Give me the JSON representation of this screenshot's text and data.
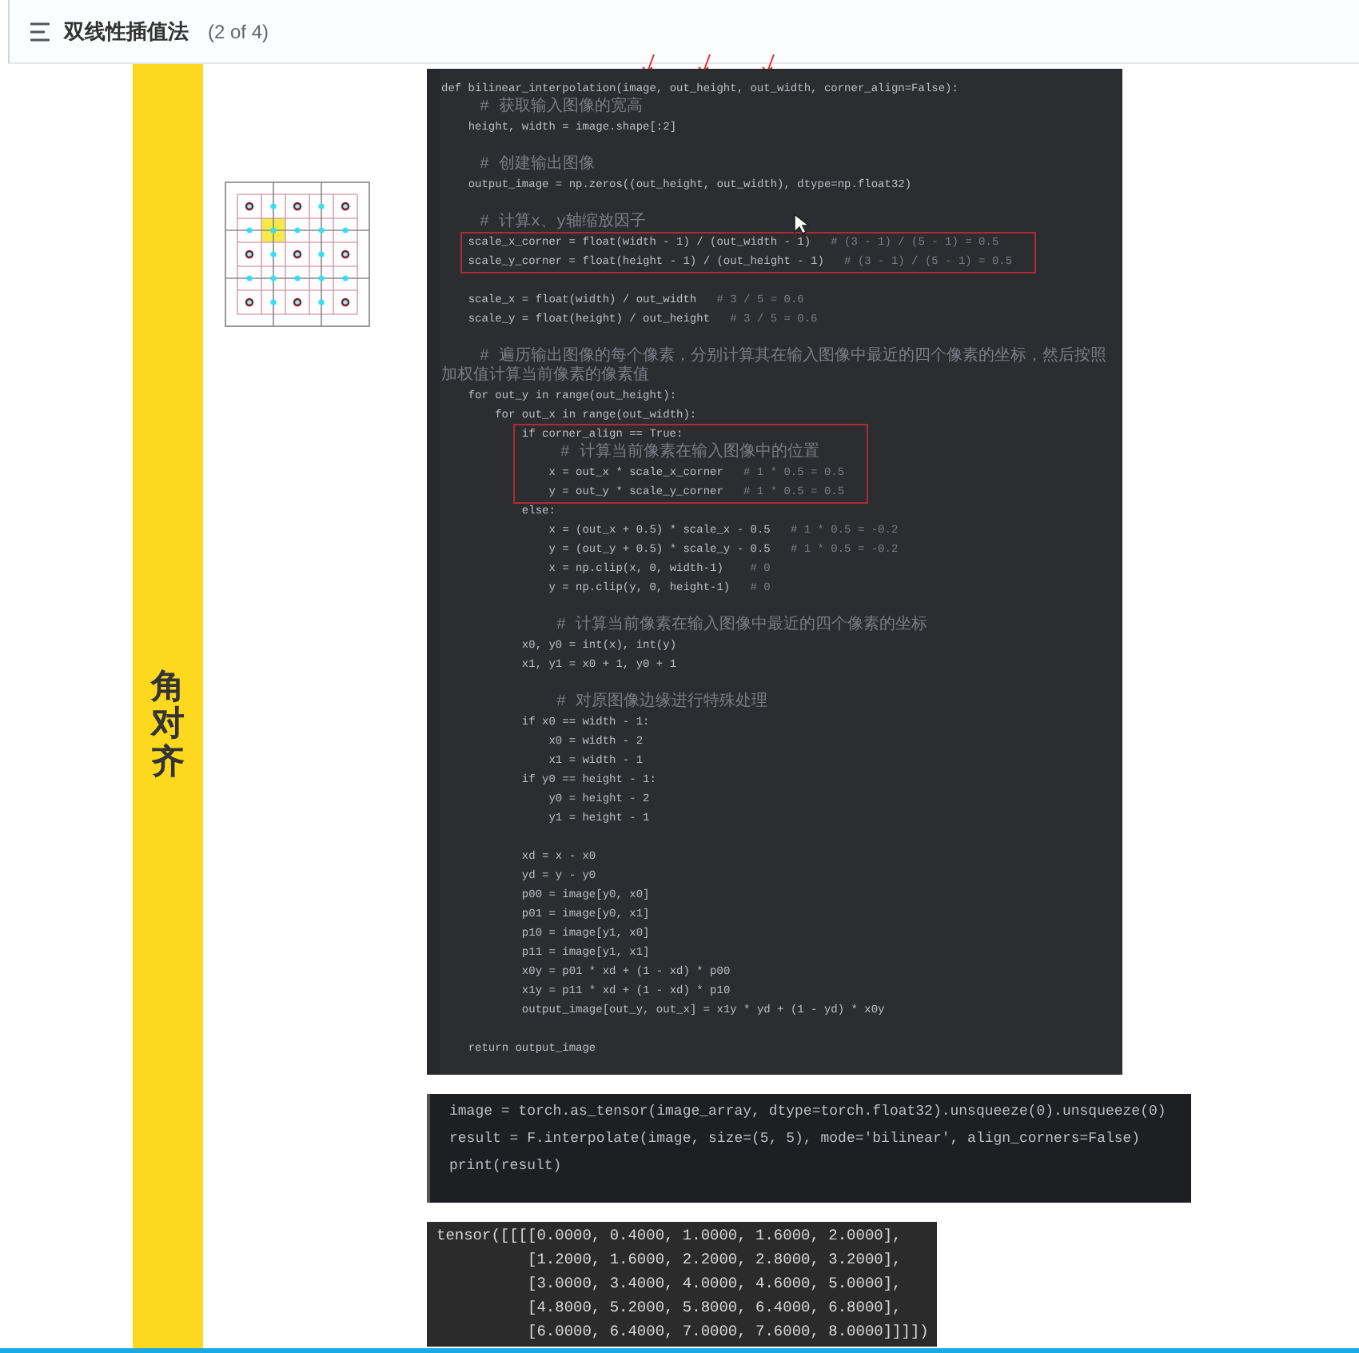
{
  "header": {
    "title": "双线性插值法",
    "page": "(2 of 4)"
  },
  "side_label": "角对齐",
  "code": {
    "groups": [
      {
        "boxed": false,
        "blank_after": true,
        "lines": [
          {
            "code": "def bilinear_interpolation(image, out_height, out_width, corner_align=False):"
          },
          {
            "note": "    # 获取输入图像的宽高"
          },
          {
            "code": "    height, width = image.shape[:2]"
          }
        ]
      },
      {
        "boxed": false,
        "blank_after": true,
        "lines": [
          {
            "note": "    # 创建输出图像"
          },
          {
            "code": "    output_image = np.zeros((out_height, out_width), dtype=np.float32)"
          }
        ]
      },
      {
        "boxed": false,
        "blank_after": false,
        "lines": [
          {
            "note": "    # 计算x、y轴缩放因子"
          }
        ]
      },
      {
        "boxed": true,
        "blank_after": true,
        "lines": [
          {
            "code": "    scale_x_corner = float(width - 1) / (out_width - 1)   ",
            "comment": "# (3 - 1) / (5 - 1) = 0.5"
          },
          {
            "code": "    scale_y_corner = float(height - 1) / (out_height - 1)   ",
            "comment": "# (3 - 1) / (5 - 1) = 0.5"
          }
        ]
      },
      {
        "boxed": false,
        "blank_after": true,
        "lines": [
          {
            "code": "    scale_x = float(width) / out_width   ",
            "comment": "# 3 / 5 = 0.6"
          },
          {
            "code": "    scale_y = float(height) / out_height   ",
            "comment": "# 3 / 5 = 0.6"
          }
        ]
      },
      {
        "boxed": false,
        "blank_after": false,
        "lines": [
          {
            "note": "    # 遍历输出图像的每个像素，分别计算其在输入图像中最近的四个像素的坐标，然后按照加权值计算当前像素的像素值"
          },
          {
            "code": "    for out_y in range(out_height):"
          },
          {
            "code": "        for out_x in range(out_width):"
          }
        ]
      },
      {
        "boxed": true,
        "blank_after": false,
        "lines": [
          {
            "code": "            if corner_align == True:"
          },
          {
            "note": "                # 计算当前像素在输入图像中的位置"
          },
          {
            "code": "                x = out_x * scale_x_corner   ",
            "comment": "# 1 * 0.5 = 0.5"
          },
          {
            "code": "                y = out_y * scale_y_corner   ",
            "comment": "# 1 * 0.5 = 0.5"
          }
        ]
      },
      {
        "boxed": false,
        "blank_after": true,
        "lines": [
          {
            "code": "            else:"
          },
          {
            "code": "                x = (out_x + 0.5) * scale_x - 0.5   ",
            "comment": "# 1 * 0.5 = -0.2"
          },
          {
            "code": "                y = (out_y + 0.5) * scale_y - 0.5   ",
            "comment": "# 1 * 0.5 = -0.2"
          },
          {
            "code": "                x = np.clip(x, 0, width-1)    ",
            "comment": "# 0"
          },
          {
            "code": "                y = np.clip(y, 0, height-1)   ",
            "comment": "# 0"
          }
        ]
      },
      {
        "boxed": false,
        "blank_after": true,
        "lines": [
          {
            "note": "            # 计算当前像素在输入图像中最近的四个像素的坐标"
          },
          {
            "code": "            x0, y0 = int(x), int(y)"
          },
          {
            "code": "            x1, y1 = x0 + 1, y0 + 1"
          }
        ]
      },
      {
        "boxed": false,
        "blank_after": true,
        "lines": [
          {
            "note": "            # 对原图像边缘进行特殊处理"
          },
          {
            "code": "            if x0 == width - 1:"
          },
          {
            "code": "                x0 = width - 2"
          },
          {
            "code": "                x1 = width - 1"
          },
          {
            "code": "            if y0 == height - 1:"
          },
          {
            "code": "                y0 = height - 2"
          },
          {
            "code": "                y1 = height - 1"
          }
        ]
      },
      {
        "boxed": false,
        "blank_after": true,
        "lines": [
          {
            "code": "            xd = x - x0"
          },
          {
            "code": "            yd = y - y0"
          },
          {
            "code": "            p00 = image[y0, x0]"
          },
          {
            "code": "            p01 = image[y0, x1]"
          },
          {
            "code": "            p10 = image[y1, x0]"
          },
          {
            "code": "            p11 = image[y1, x1]"
          },
          {
            "code": "            x0y = p01 * xd + (1 - xd) * p00"
          },
          {
            "code": "            x1y = p11 * xd + (1 - xd) * p10"
          },
          {
            "code": "            output_image[out_y, out_x] = x1y * yd + (1 - yd) * x0y"
          }
        ]
      },
      {
        "boxed": false,
        "blank_after": false,
        "lines": [
          {
            "code": "    return output_image"
          }
        ]
      }
    ]
  },
  "cell": {
    "lines": [
      "image = torch.as_tensor(image_array, dtype=torch.float32).unsqueeze(0).unsqueeze(0)",
      "result = F.interpolate(image, size=(5, 5), mode='bilinear', align_corners=False)",
      "print(result)"
    ]
  },
  "output": {
    "lines": [
      "tensor([[[[0.0000, 0.4000, 1.0000, 1.6000, 2.0000],",
      "          [1.2000, 1.6000, 2.2000, 2.8000, 3.2000],",
      "          [3.0000, 3.4000, 4.0000, 4.6000, 5.0000],",
      "          [4.8000, 5.2000, 5.8000, 6.4000, 6.8000],",
      "          [6.0000, 6.4000, 7.0000, 7.6000, 8.0000]]]])"
    ]
  }
}
